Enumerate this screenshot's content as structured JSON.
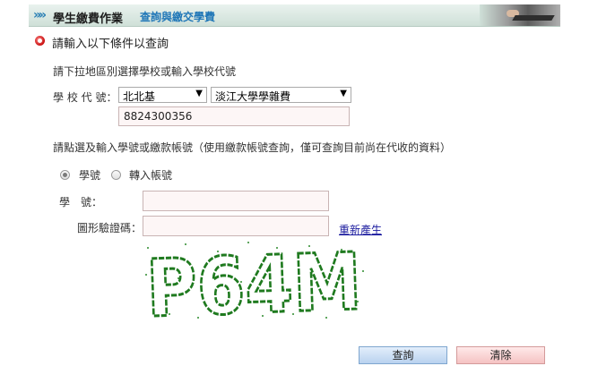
{
  "header": {
    "title": "學生繳費作業",
    "subtitle": "查詢與繳交學費"
  },
  "section_title": "請輸入以下條件以查詢",
  "school": {
    "instruction": "請下拉地區別選擇學校或輸入學校代號",
    "label": "學 校 代 號：",
    "region_selected": "北北基",
    "school_selected": "淡江大學學雜費",
    "code_value": "8824300356"
  },
  "query": {
    "instruction": "請點選及輸入學號或繳款帳號（使用繳款帳號查詢，僅可查詢目前尚在代收的資料）",
    "radio_student_id": "學號",
    "radio_transfer_account": "轉入帳號",
    "student_id_label": "學　號：",
    "captcha_label": "圖形驗證碼：",
    "regenerate_link": "重新產生",
    "captcha_text": "P64M"
  },
  "buttons": {
    "query": "查詢",
    "clear": "清除"
  },
  "colors": {
    "header_link": "#1f76b7",
    "captcha_green": "#1f7a1f"
  }
}
